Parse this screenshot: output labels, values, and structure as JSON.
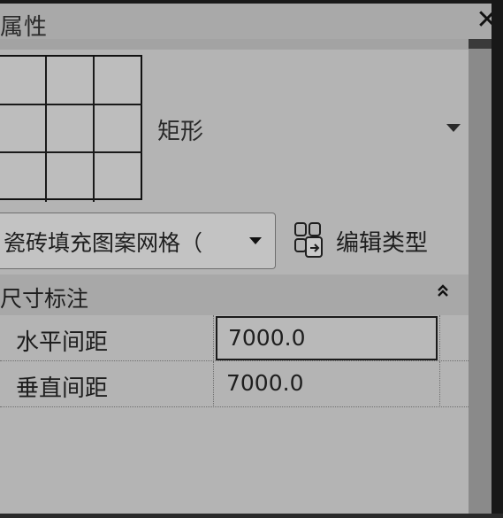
{
  "title": "属性",
  "close_glyph": "✕",
  "type_preview": {
    "name": "矩形"
  },
  "type_selector": {
    "selected": "瓷砖填充图案网格（",
    "arrow": "▼"
  },
  "edit_type": {
    "label": "编辑类型"
  },
  "group": {
    "title": "尺寸标注",
    "collapse_glyph": "«"
  },
  "properties": [
    {
      "label": "水平间距",
      "value": "7000.0",
      "active": true
    },
    {
      "label": "垂直间距",
      "value": "7000.0",
      "active": false
    }
  ],
  "icons": {
    "close": "close-icon",
    "dropdown": "chevron-down-icon",
    "edit_type": "edit-type-icon",
    "collapse": "collapse-up-icon"
  }
}
